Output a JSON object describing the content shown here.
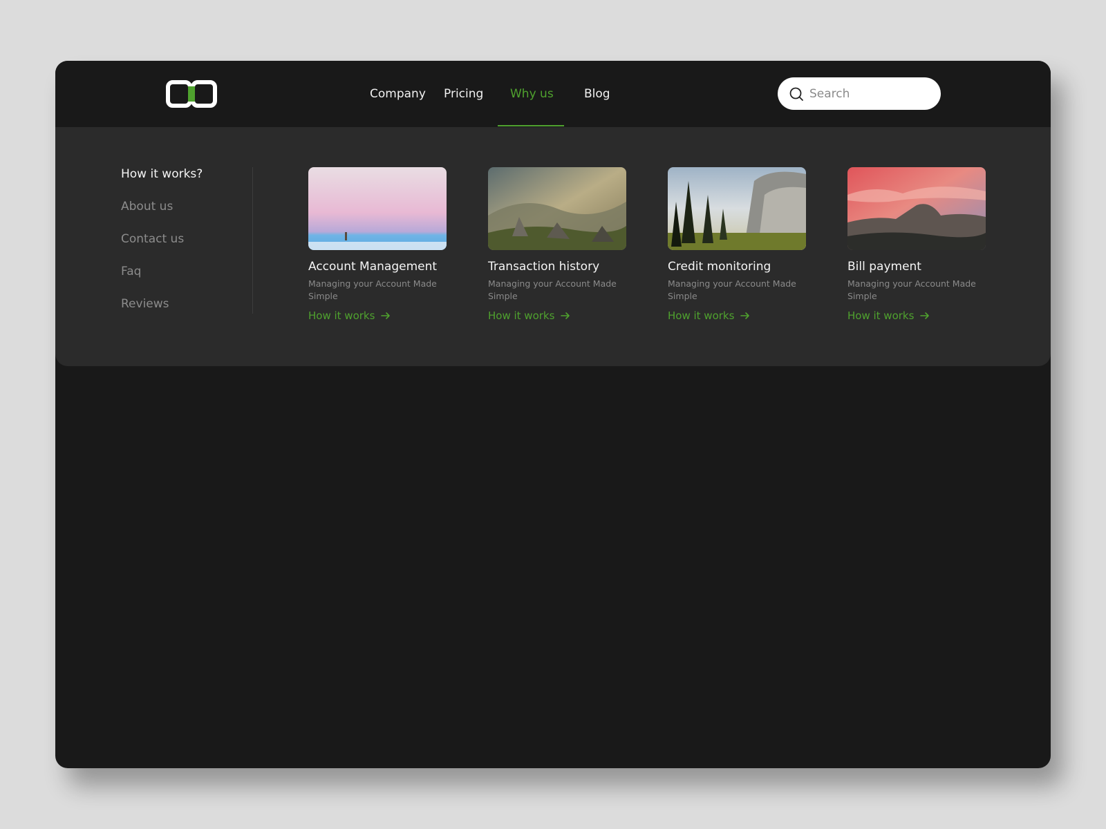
{
  "nav": {
    "links": [
      {
        "label": "Company"
      },
      {
        "label": "Pricing"
      },
      {
        "label": "Why us",
        "active": true
      },
      {
        "label": "Blog"
      }
    ]
  },
  "search": {
    "placeholder": "Search",
    "icon": "search-icon"
  },
  "side_menu": {
    "items": [
      {
        "label": "How it works?"
      },
      {
        "label": "About us"
      },
      {
        "label": "Contact us"
      },
      {
        "label": "Faq"
      },
      {
        "label": "Reviews"
      }
    ]
  },
  "cards": [
    {
      "title": "Account Management",
      "description": "Managing your Account Made Simple",
      "link": "How it works",
      "image": "pastel-horizon-photo"
    },
    {
      "title": "Transaction history",
      "description": "Managing your Account Made Simple",
      "link": "How it works",
      "image": "hazy-mountain-photo"
    },
    {
      "title": "Credit monitoring",
      "description": "Managing your Account Made Simple",
      "link": "How it works",
      "image": "granite-cliff-forest-photo"
    },
    {
      "title": "Bill payment",
      "description": "Managing your Account Made Simple",
      "link": "How it works",
      "image": "sunset-half-dome-photo"
    }
  ],
  "colors": {
    "accent": "#4fa22e",
    "background": "#dcdcdc",
    "nav_bg": "#191919",
    "menu_bg": "#2b2b2b"
  }
}
